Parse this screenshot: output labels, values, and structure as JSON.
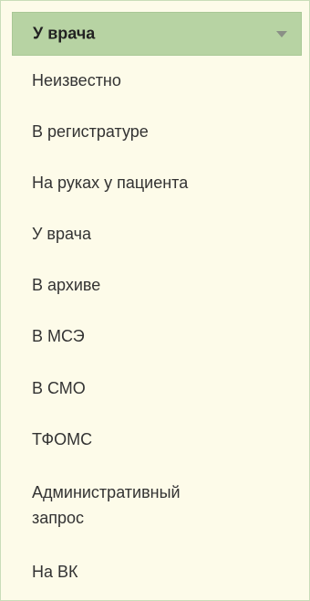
{
  "dropdown": {
    "selected_label": "У врача",
    "icon": "chevron-down-icon",
    "options": [
      "Неизвестно",
      "В регистратуре",
      "На руках у пациента",
      "У врача",
      "В архиве",
      "В МСЭ",
      "В СМО",
      "ТФОМС",
      "Административный запрос",
      "На ВК"
    ]
  },
  "colors": {
    "header_bg": "#b7d3a3",
    "list_bg": "#fdfbe9",
    "text": "#333333"
  }
}
